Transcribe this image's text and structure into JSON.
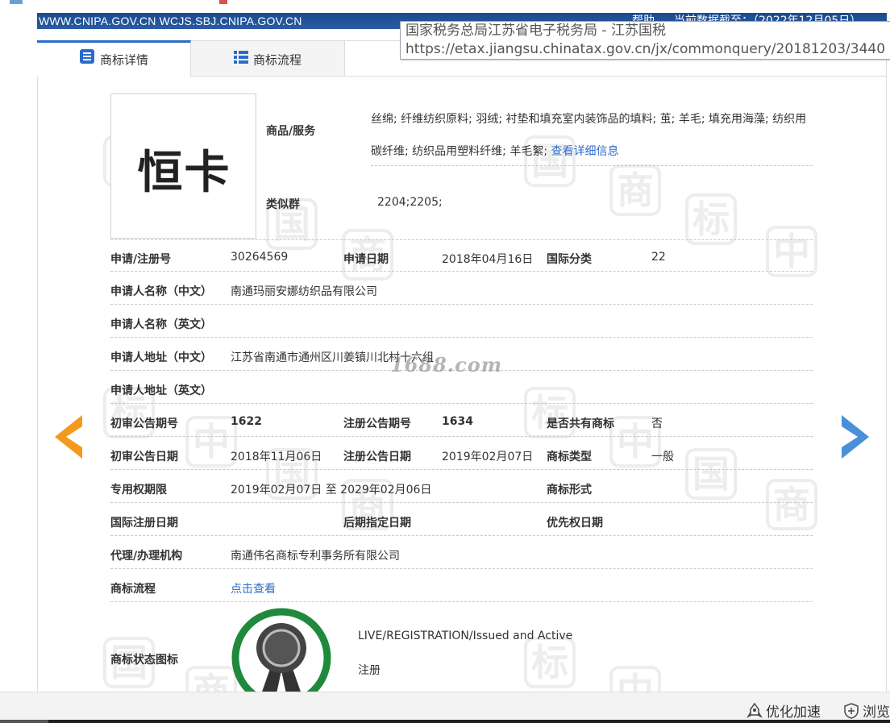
{
  "header": {
    "site_url": "WWW.CNIPA.GOV.CN WCJS.SBJ.CNIPA.GOV.CN",
    "help": "帮助",
    "data_as_of": "当前数据截至：（2022年12月05日）"
  },
  "tooltip": {
    "title": "国家税务总局江苏省电子税务局 - 江苏国税",
    "url": "https://etax.jiangsu.chinatax.gov.cn/jx/commonquery/20181203/3440"
  },
  "tabs": [
    {
      "label": "商标详情",
      "active": true
    },
    {
      "label": "商标流程",
      "active": false
    }
  ],
  "trademark": {
    "mark_text": "恒卡",
    "goods_label": "商品/服务",
    "goods_text": "丝绵; 纤维纺织原料; 羽绒; 衬垫和填充室内装饰品的填料; 茧; 羊毛; 填充用海藻; 纺织用碳纤维; 纺织品用塑料纤维; 羊毛絮;",
    "goods_link": "查看详细信息",
    "similar_label": "类似群",
    "similar_value": "2204;2205;"
  },
  "rows": {
    "app_no_label": "申请/注册号",
    "app_no": "30264569",
    "app_date_label": "申请日期",
    "app_date": "2018年04月16日",
    "intl_class_label": "国际分类",
    "intl_class": "22",
    "applicant_cn_label": "申请人名称（中文）",
    "applicant_cn": "南通玛丽安娜纺织品有限公司",
    "applicant_en_label": "申请人名称（英文）",
    "address_cn_label": "申请人地址（中文）",
    "address_cn": "江苏省南通市通州区川姜镇川北村十六组",
    "address_en_label": "申请人地址（英文）",
    "prelim_no_label": "初审公告期号",
    "prelim_no": "1622",
    "reg_no_label": "注册公告期号",
    "reg_no": "1634",
    "shared_label": "是否共有商标",
    "shared": "否",
    "prelim_date_label": "初审公告日期",
    "prelim_date": "2018年11月06日",
    "reg_date_label": "注册公告日期",
    "reg_date": "2019年02月07日",
    "type_label": "商标类型",
    "type": "一般",
    "term_label": "专用权期限",
    "term": "2019年02月07日 至 2029年02月06日",
    "form_label": "商标形式",
    "intl_reg_date_label": "国际注册日期",
    "later_date_label": "后期指定日期",
    "priority_label": "优先权日期",
    "agent_label": "代理/办理机构",
    "agent": "南通伟名商标专利事务所有限公司",
    "flow_label": "商标流程",
    "flow_link": "点击查看"
  },
  "status": {
    "label": "商标状态图标",
    "en": "LIVE/REGISTRATION/Issued and Active",
    "cn": "注册"
  },
  "watermark": "1688.com",
  "bottom_bar": {
    "optimize": "优化加速",
    "browse": "浏览"
  },
  "colors": {
    "header_blue": "#1a4b8f",
    "link_blue": "#2d6bc9",
    "arrow_orange": "#f39a1e",
    "arrow_blue": "#4a90d9",
    "seal_green": "#1f8a3b"
  }
}
